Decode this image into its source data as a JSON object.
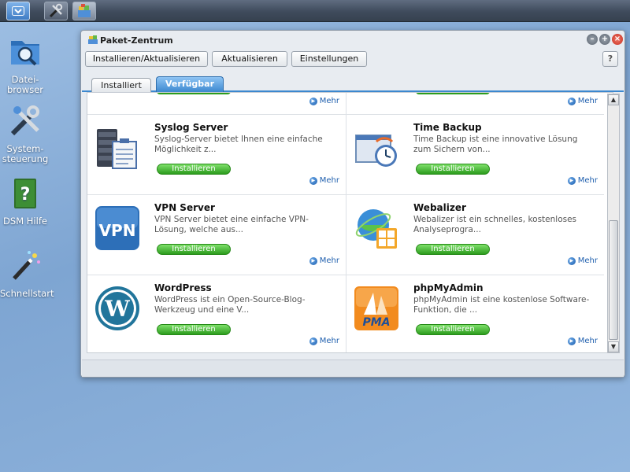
{
  "window": {
    "title": "Paket-Zentrum"
  },
  "toolbar": {
    "install_update": "Installieren/Aktualisieren",
    "update": "Aktualisieren",
    "settings": "Einstellungen",
    "help": "?"
  },
  "tabs": [
    {
      "label": "Installiert",
      "active": false
    },
    {
      "label": "Verfügbar",
      "active": true
    }
  ],
  "desktop_icons": [
    {
      "label": "Datei-\nbrowser",
      "icon": "folder-search-icon"
    },
    {
      "label": "System-\nsteuerung",
      "icon": "tools-icon"
    },
    {
      "label": "DSM Hilfe",
      "icon": "help-book-icon"
    },
    {
      "label": "Schnellstart",
      "icon": "magic-wand-icon"
    }
  ],
  "more_label": "Mehr",
  "install_label": "Installieren",
  "packages": [
    {
      "name": "Syslog Server",
      "desc": "Syslog-Server bietet Ihnen eine einfache Möglichkeit z...",
      "icon": "syslog-server-icon"
    },
    {
      "name": "Time Backup",
      "desc": "Time Backup ist eine innovative Lösung zum Sichern von...",
      "icon": "time-backup-icon"
    },
    {
      "name": "VPN Server",
      "desc": "VPN Server bietet eine einfache VPN-Lösung, welche aus...",
      "icon": "vpn-server-icon"
    },
    {
      "name": "Webalizer",
      "desc": "Webalizer ist ein schnelles, kostenloses Analyseprogra...",
      "icon": "webalizer-icon"
    },
    {
      "name": "WordPress",
      "desc": "WordPress ist ein Open-Source-Blog-Werkzeug und eine V...",
      "icon": "wordpress-icon"
    },
    {
      "name": "phpMyAdmin",
      "desc": "phpMyAdmin ist eine kostenlose Software-Funktion, die ...",
      "icon": "phpmyadmin-icon"
    }
  ],
  "colors": {
    "accent": "#3c88cf",
    "install_green": "#2c9c1d",
    "close_red": "#c72d1f",
    "desktop_blue": "#88acd6"
  }
}
